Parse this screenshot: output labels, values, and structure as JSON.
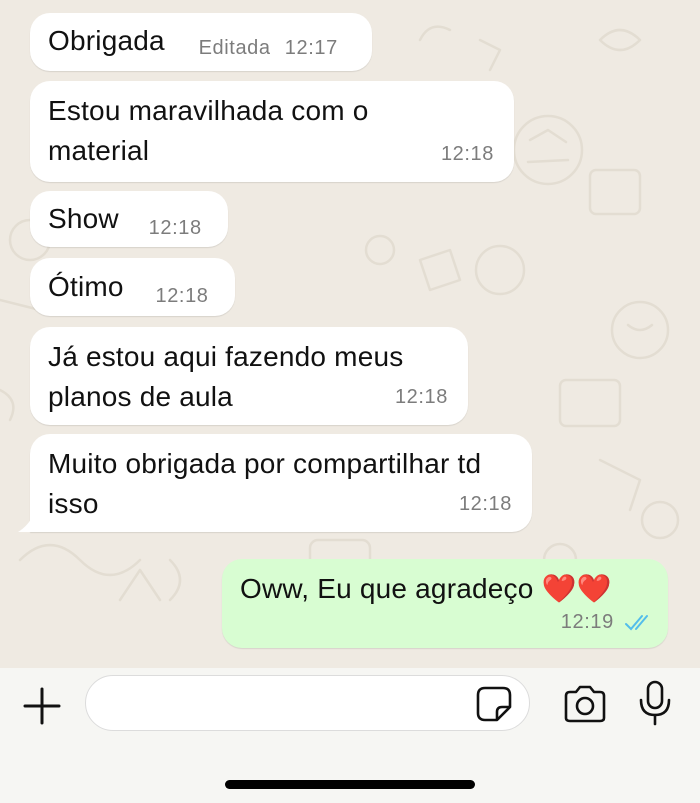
{
  "messages": [
    {
      "dir": "in",
      "text": "Obrigada",
      "edited_label": "Editada",
      "time": "12:17"
    },
    {
      "dir": "in",
      "text": "Estou maravilhada com o material",
      "time": "12:18"
    },
    {
      "dir": "in",
      "text": "Show",
      "time": "12:18"
    },
    {
      "dir": "in",
      "text": "Ótimo",
      "time": "12:18"
    },
    {
      "dir": "in",
      "text": "Já estou aqui fazendo meus planos de aula",
      "time": "12:18"
    },
    {
      "dir": "in",
      "text": "Muito obrigada por compartilhar td isso",
      "time": "12:18"
    },
    {
      "dir": "out",
      "text": "Oww, Eu que agradeço ❤️❤️",
      "time": "12:19",
      "status": "read"
    }
  ],
  "composer": {
    "placeholder": "",
    "icons": [
      "plus-icon",
      "sticker-icon",
      "camera-icon",
      "microphone-icon"
    ]
  },
  "colors": {
    "incoming_bubble": "#ffffff",
    "outgoing_bubble": "#d8fdd2",
    "read_ticks": "#53bdeb",
    "wallpaper": "#efeae2"
  }
}
